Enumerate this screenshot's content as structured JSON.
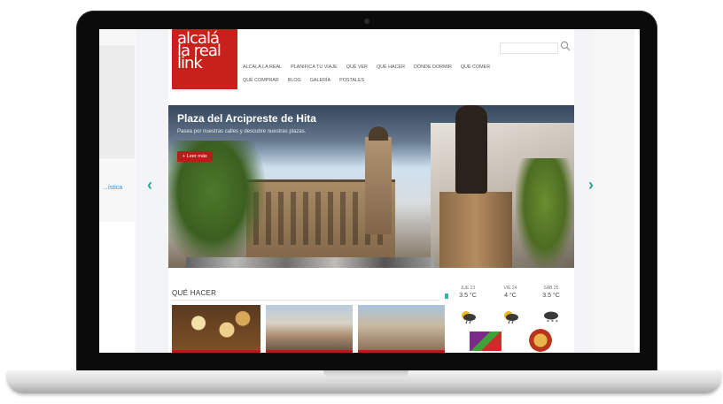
{
  "site": {
    "logo_lines": [
      "alcalá",
      "la real",
      "link"
    ],
    "search_placeholder": ""
  },
  "nav": {
    "row1": [
      "ALCALÁ LA REAL",
      "PLANIFICA TU VIAJE",
      "QUÉ VER",
      "QUÉ HACER",
      "DÓNDE DORMIR",
      "QUÉ COMER"
    ],
    "row2": [
      "QUÉ COMPRAR",
      "BLOG",
      "GALERÍA",
      "POSTALES"
    ]
  },
  "hero": {
    "title": "Plaza del Arcipreste de Hita",
    "subtitle": "Pasea por nuestras calles y descubre nuestras plazas.",
    "button": "+ Leer más"
  },
  "section": {
    "title": "QUÉ HACER"
  },
  "weather": {
    "days": [
      {
        "label": "JUE 23",
        "temp": "3.5 °C"
      },
      {
        "label": "VIE 24",
        "temp": "4 °C"
      },
      {
        "label": "SÁB 25",
        "temp": "3.5 °C"
      }
    ],
    "icons": [
      "sun-rain-icon",
      "sun-rain-icon",
      "snow-cloud-icon"
    ]
  },
  "side": {
    "link_text": "...ística"
  },
  "colors": {
    "brand_red": "#c8201a",
    "accent_teal": "#2aa59a"
  }
}
